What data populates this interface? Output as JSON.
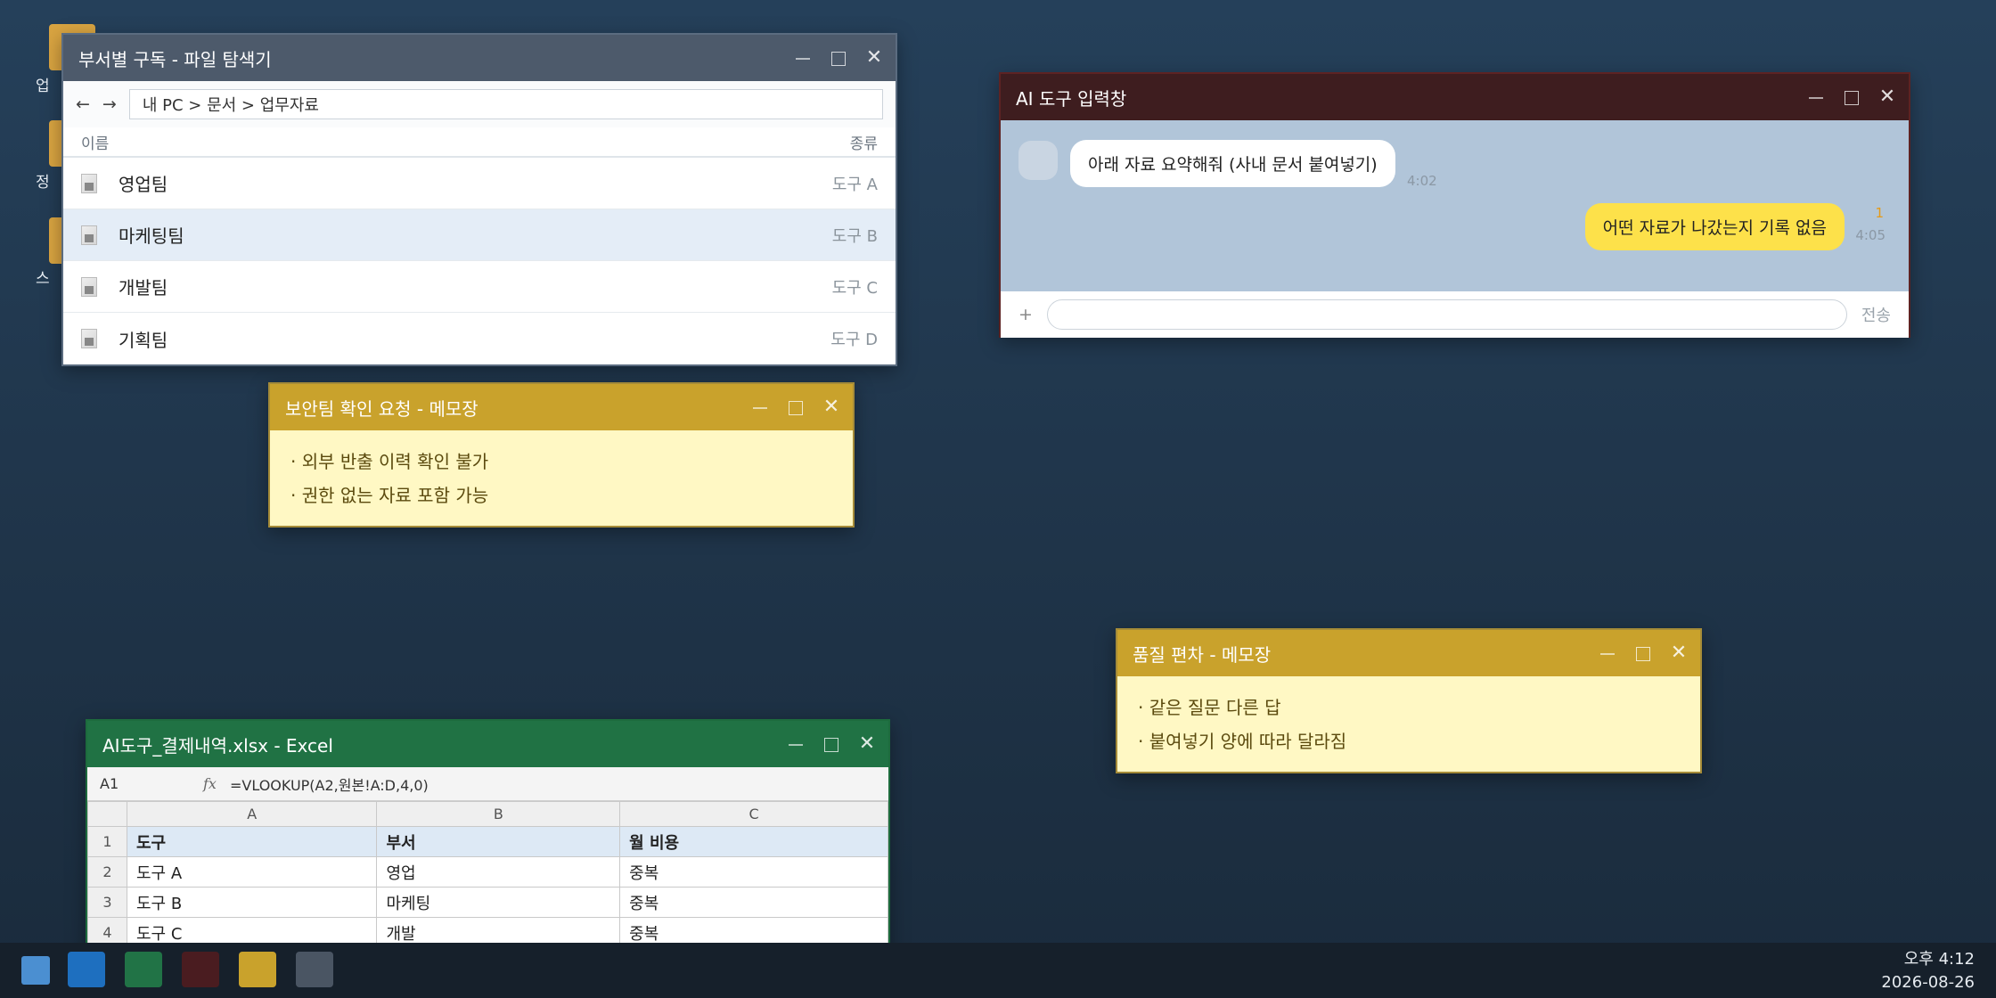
{
  "desktop": {
    "icons": [
      {
        "name": "folder-icon",
        "label": "업"
      },
      {
        "name": "folder-icon",
        "label": "정"
      },
      {
        "name": "folder-icon",
        "label": "스"
      }
    ]
  },
  "explorer": {
    "title": "부서별 구독 - 파일 탐색기",
    "back": "←",
    "forward": "→",
    "address": "내 PC > 문서 > 업무자료",
    "col_name": "이름",
    "col_type": "종류",
    "rows": [
      {
        "name": "영업팀",
        "type": "도구 A",
        "selected": false
      },
      {
        "name": "마케팅팀",
        "type": "도구 B",
        "selected": true
      },
      {
        "name": "개발팀",
        "type": "도구 C",
        "selected": false
      },
      {
        "name": "기획팀",
        "type": "도구 D",
        "selected": false
      }
    ]
  },
  "aichat": {
    "title": "AI 도구 입력창",
    "msg_in": "아래 자료 요약해줘 (사내 문서 붙여넣기)",
    "time_in": "4:02",
    "msg_out": "어떤 자료가 나갔는지 기록 없음",
    "unread": "1",
    "time_out": "4:05",
    "plus": "+",
    "input_value": "",
    "send": "전송"
  },
  "memo1": {
    "title": "보안팀 확인 요청 - 메모장",
    "lines": [
      "· 외부 반출 이력 확인 불가",
      "· 권한 없는 자료 포함 가능"
    ]
  },
  "memo2": {
    "title": "품질 편차 - 메모장",
    "lines": [
      "· 같은 질문 다른 답",
      "· 붙여넣기 양에 따라 달라짐"
    ]
  },
  "excel": {
    "title": "AI도구_결제내역.xlsx - Excel",
    "cell_ref": "A1",
    "fx": "fx",
    "formula": "=VLOOKUP(A2,원본!A:D,4,0)",
    "columns": [
      "A",
      "B",
      "C"
    ],
    "rows": [
      {
        "n": "1",
        "cells": [
          "도구",
          "부서",
          "월 비용"
        ]
      },
      {
        "n": "2",
        "cells": [
          "도구 A",
          "영업",
          "중복"
        ]
      },
      {
        "n": "3",
        "cells": [
          "도구 B",
          "마케팅",
          "중복"
        ]
      },
      {
        "n": "4",
        "cells": [
          "도구 C",
          "개발",
          "중복"
        ]
      }
    ]
  },
  "taskbar": {
    "buttons": [
      {
        "name": "taskbar-explorer-button",
        "color": "#1e6fbf"
      },
      {
        "name": "taskbar-excel-button",
        "color": "#217346"
      },
      {
        "name": "taskbar-aichat-button",
        "color": "#4a1c20"
      },
      {
        "name": "taskbar-memo-button",
        "color": "#c9a22c"
      },
      {
        "name": "taskbar-app-button",
        "color": "#4a5563"
      }
    ],
    "time": "오후 4:12",
    "date": "2026-08-26"
  }
}
